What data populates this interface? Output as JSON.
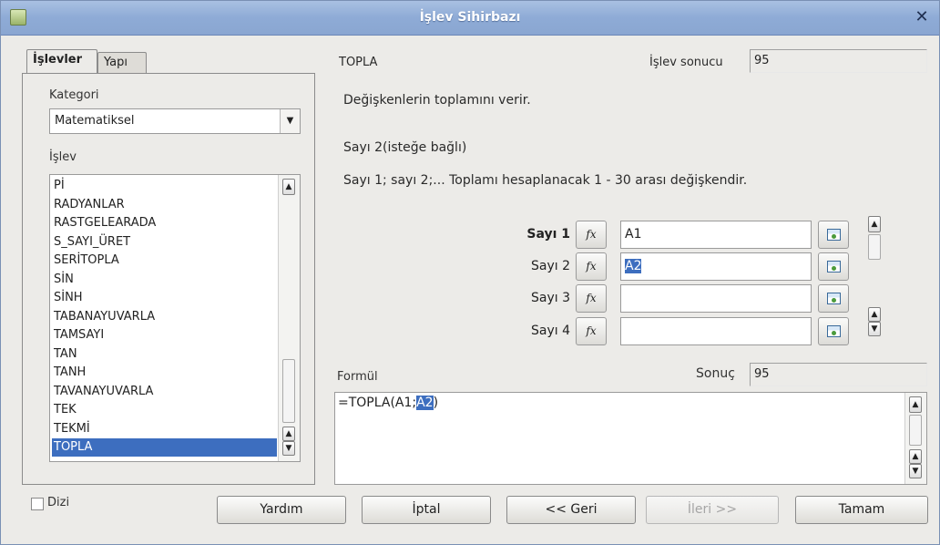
{
  "window": {
    "title": "İşlev Sihirbazı"
  },
  "tabs": [
    {
      "label": "İşlevler"
    },
    {
      "label": "Yapı"
    }
  ],
  "category": {
    "label": "Kategori",
    "value": "Matematiksel"
  },
  "function_list": {
    "label": "İşlev",
    "items": [
      "Pİ",
      "RADYANLAR",
      "RASTGELEARADA",
      "S_SAYI_ÜRET",
      "SERİTOPLA",
      "SİN",
      "SİNH",
      "TABANAYUVARLA",
      "TAMSAYI",
      "TAN",
      "TANH",
      "TAVANAYUVARLA",
      "TEK",
      "TEKMİ",
      "TOPLA"
    ],
    "selected_index": 14
  },
  "function": {
    "name": "TOPLA",
    "result_label": "İşlev sonucu",
    "result_value": "95",
    "description": "Değişkenlerin toplamını verir.",
    "arg_title": "Sayı 2(isteğe bağlı)",
    "arg_description": "Sayı 1; sayı 2;... Toplamı hesaplanacak 1 - 30 arası değişkendir."
  },
  "arguments": [
    {
      "label": "Sayı 1",
      "fx": "fx",
      "value": "A1",
      "selected": false
    },
    {
      "label": "Sayı 2",
      "fx": "fx",
      "value": "A2",
      "selected": true
    },
    {
      "label": "Sayı 3",
      "fx": "fx",
      "value": "",
      "selected": false
    },
    {
      "label": "Sayı 4",
      "fx": "fx",
      "value": "",
      "selected": false
    }
  ],
  "formula": {
    "label": "Formül",
    "result_label": "Sonuç",
    "result_value": "95",
    "text_before": "=TOPLA(A1;",
    "text_selected": "A2",
    "text_after": ")"
  },
  "array_checkbox": {
    "label": "Dizi",
    "checked": false
  },
  "buttons": {
    "help": "Yardım",
    "cancel": "İptal",
    "back": "<< Geri",
    "next": "İleri >>",
    "ok": "Tamam"
  },
  "scroll_glyphs": {
    "up": "▲",
    "down": "▼"
  }
}
